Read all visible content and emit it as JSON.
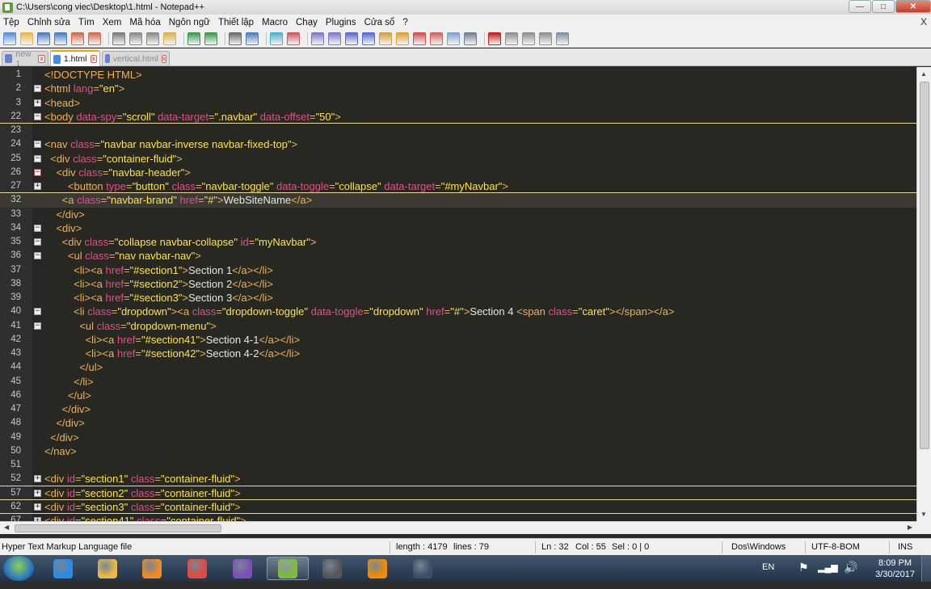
{
  "window": {
    "title": "C:\\Users\\cong viec\\Desktop\\1.html - Notepad++",
    "controls": {
      "minimize": "—",
      "restore": "□",
      "close": "✕"
    }
  },
  "menu": {
    "items": [
      "Tệp",
      "Chỉnh sửa",
      "Tìm",
      "Xem",
      "Mã hóa",
      "Ngôn ngữ",
      "Thiết lập",
      "Macro",
      "Chạy",
      "Plugins",
      "Cửa sổ",
      "?"
    ],
    "doc_close": "X"
  },
  "toolbar": {
    "icons": [
      "new-file-icon",
      "open-file-icon",
      "save-icon",
      "save-all-icon",
      "close-icon",
      "close-all-icon",
      "print-icon",
      "cut-icon",
      "copy-icon",
      "paste-icon",
      "undo-icon",
      "redo-icon",
      "find-icon",
      "replace-icon",
      "zoom-in-icon",
      "zoom-out-icon",
      "sync-v-icon",
      "sync-h-icon",
      "word-wrap-icon",
      "all-chars-icon",
      "indent-guide-icon",
      "folder-icon",
      "function-list-icon",
      "doc-map-icon",
      "panel-icon",
      "monitor-icon",
      "record-macro-icon",
      "stop-macro-icon",
      "play-macro-icon",
      "run-macro-multiple-icon",
      "save-macro-icon"
    ]
  },
  "tabs": [
    {
      "label": "new 1",
      "active": false
    },
    {
      "label": "1.html",
      "active": true
    },
    {
      "label": "vertical.html",
      "active": false
    }
  ],
  "editor": {
    "lines": [
      {
        "n": "1",
        "fold": "",
        "segs": [
          [
            "t",
            "<!DOCTYPE HTML>"
          ]
        ]
      },
      {
        "n": "2",
        "fold": "-",
        "segs": [
          [
            "t",
            "<html "
          ],
          [
            "a",
            "lang"
          ],
          [
            "t",
            "="
          ],
          [
            "v",
            "\"en\""
          ],
          [
            "t",
            ">"
          ]
        ]
      },
      {
        "n": "3",
        "fold": "+",
        "segs": [
          [
            "t",
            "<head>"
          ]
        ]
      },
      {
        "n": "22",
        "fold": "-",
        "segs": [
          [
            "t",
            "<body "
          ],
          [
            "a",
            "data-spy"
          ],
          [
            "t",
            "="
          ],
          [
            "v",
            "\"scroll\""
          ],
          [
            "t",
            " "
          ],
          [
            "a",
            "data-target"
          ],
          [
            "t",
            "="
          ],
          [
            "v",
            "\".navbar\""
          ],
          [
            "t",
            " "
          ],
          [
            "a",
            "data-offset"
          ],
          [
            "t",
            "="
          ],
          [
            "v",
            "\"50\""
          ],
          [
            "t",
            ">"
          ]
        ],
        "underline": true
      },
      {
        "n": "23",
        "fold": "",
        "segs": []
      },
      {
        "n": "24",
        "fold": "-",
        "segs": [
          [
            "t",
            "<nav "
          ],
          [
            "a",
            "class"
          ],
          [
            "t",
            "="
          ],
          [
            "v",
            "\"navbar navbar-inverse navbar-fixed-top\""
          ],
          [
            "t",
            ">"
          ]
        ]
      },
      {
        "n": "25",
        "fold": "-",
        "segs": [
          [
            "tx",
            "  "
          ],
          [
            "t",
            "<div "
          ],
          [
            "a",
            "class"
          ],
          [
            "t",
            "="
          ],
          [
            "v",
            "\"container-fluid\""
          ],
          [
            "t",
            ">"
          ]
        ]
      },
      {
        "n": "26",
        "fold": "-r",
        "segs": [
          [
            "tx",
            "    "
          ],
          [
            "t",
            "<div "
          ],
          [
            "a",
            "class"
          ],
          [
            "t",
            "="
          ],
          [
            "v",
            "\"navbar-header\""
          ],
          [
            "t",
            ">"
          ]
        ]
      },
      {
        "n": "27",
        "fold": "+",
        "segs": [
          [
            "tx",
            "        "
          ],
          [
            "t",
            "<button "
          ],
          [
            "a",
            "type"
          ],
          [
            "t",
            "="
          ],
          [
            "v",
            "\"button\""
          ],
          [
            "t",
            " "
          ],
          [
            "a",
            "class"
          ],
          [
            "t",
            "="
          ],
          [
            "v",
            "\"navbar-toggle\""
          ],
          [
            "t",
            " "
          ],
          [
            "a",
            "data-toggle"
          ],
          [
            "t",
            "="
          ],
          [
            "v",
            "\"collapse\""
          ],
          [
            "t",
            " "
          ],
          [
            "a",
            "data-target"
          ],
          [
            "t",
            "="
          ],
          [
            "v",
            "\"#myNavbar\""
          ],
          [
            "t",
            ">"
          ]
        ],
        "underline": true
      },
      {
        "n": "32",
        "fold": "",
        "segs": [
          [
            "tx",
            "      "
          ],
          [
            "t",
            "<a "
          ],
          [
            "a",
            "class"
          ],
          [
            "t",
            "="
          ],
          [
            "v",
            "\"navbar-brand\""
          ],
          [
            "t",
            " "
          ],
          [
            "a",
            "href"
          ],
          [
            "t",
            "="
          ],
          [
            "v",
            "\"#\""
          ],
          [
            "t",
            ">"
          ],
          [
            "tx",
            "WebSiteName"
          ],
          [
            "t",
            "</a>"
          ]
        ],
        "current": true
      },
      {
        "n": "33",
        "fold": "",
        "segs": [
          [
            "tx",
            "    "
          ],
          [
            "t",
            "</div>"
          ]
        ]
      },
      {
        "n": "34",
        "fold": "-",
        "segs": [
          [
            "tx",
            "    "
          ],
          [
            "t",
            "<div>"
          ]
        ]
      },
      {
        "n": "35",
        "fold": "-",
        "segs": [
          [
            "tx",
            "      "
          ],
          [
            "t",
            "<div "
          ],
          [
            "a",
            "class"
          ],
          [
            "t",
            "="
          ],
          [
            "v",
            "\"collapse navbar-collapse\""
          ],
          [
            "t",
            " "
          ],
          [
            "a",
            "id"
          ],
          [
            "t",
            "="
          ],
          [
            "v",
            "\"myNavbar\""
          ],
          [
            "t",
            ">"
          ]
        ]
      },
      {
        "n": "36",
        "fold": "-",
        "segs": [
          [
            "tx",
            "        "
          ],
          [
            "t",
            "<ul "
          ],
          [
            "a",
            "class"
          ],
          [
            "t",
            "="
          ],
          [
            "v",
            "\"nav navbar-nav\""
          ],
          [
            "t",
            ">"
          ]
        ]
      },
      {
        "n": "37",
        "fold": "",
        "segs": [
          [
            "tx",
            "          "
          ],
          [
            "t",
            "<li><a "
          ],
          [
            "a",
            "href"
          ],
          [
            "t",
            "="
          ],
          [
            "v",
            "\"#section1\""
          ],
          [
            "t",
            ">"
          ],
          [
            "tx",
            "Section 1"
          ],
          [
            "t",
            "</a></li>"
          ]
        ]
      },
      {
        "n": "38",
        "fold": "",
        "segs": [
          [
            "tx",
            "          "
          ],
          [
            "t",
            "<li><a "
          ],
          [
            "a",
            "href"
          ],
          [
            "t",
            "="
          ],
          [
            "v",
            "\"#section2\""
          ],
          [
            "t",
            ">"
          ],
          [
            "tx",
            "Section 2"
          ],
          [
            "t",
            "</a></li>"
          ]
        ]
      },
      {
        "n": "39",
        "fold": "",
        "segs": [
          [
            "tx",
            "          "
          ],
          [
            "t",
            "<li><a "
          ],
          [
            "a",
            "href"
          ],
          [
            "t",
            "="
          ],
          [
            "v",
            "\"#section3\""
          ],
          [
            "t",
            ">"
          ],
          [
            "tx",
            "Section 3"
          ],
          [
            "t",
            "</a></li>"
          ]
        ]
      },
      {
        "n": "40",
        "fold": "-",
        "segs": [
          [
            "tx",
            "          "
          ],
          [
            "t",
            "<li "
          ],
          [
            "a",
            "class"
          ],
          [
            "t",
            "="
          ],
          [
            "v",
            "\"dropdown\""
          ],
          [
            "t",
            "><a "
          ],
          [
            "a",
            "class"
          ],
          [
            "t",
            "="
          ],
          [
            "v",
            "\"dropdown-toggle\""
          ],
          [
            "t",
            " "
          ],
          [
            "a",
            "data-toggle"
          ],
          [
            "t",
            "="
          ],
          [
            "v",
            "\"dropdown\""
          ],
          [
            "t",
            " "
          ],
          [
            "a",
            "href"
          ],
          [
            "t",
            "="
          ],
          [
            "v",
            "\"#\""
          ],
          [
            "t",
            ">"
          ],
          [
            "tx",
            "Section 4 "
          ],
          [
            "t",
            "<span "
          ],
          [
            "a",
            "class"
          ],
          [
            "t",
            "="
          ],
          [
            "v",
            "\"caret\""
          ],
          [
            "t",
            "></span></a>"
          ]
        ]
      },
      {
        "n": "41",
        "fold": "-",
        "segs": [
          [
            "tx",
            "            "
          ],
          [
            "t",
            "<ul "
          ],
          [
            "a",
            "class"
          ],
          [
            "t",
            "="
          ],
          [
            "v",
            "\"dropdown-menu\""
          ],
          [
            "t",
            ">"
          ]
        ]
      },
      {
        "n": "42",
        "fold": "",
        "segs": [
          [
            "tx",
            "              "
          ],
          [
            "t",
            "<li><a "
          ],
          [
            "a",
            "href"
          ],
          [
            "t",
            "="
          ],
          [
            "v",
            "\"#section41\""
          ],
          [
            "t",
            ">"
          ],
          [
            "tx",
            "Section 4-1"
          ],
          [
            "t",
            "</a></li>"
          ]
        ]
      },
      {
        "n": "43",
        "fold": "",
        "segs": [
          [
            "tx",
            "              "
          ],
          [
            "t",
            "<li><a "
          ],
          [
            "a",
            "href"
          ],
          [
            "t",
            "="
          ],
          [
            "v",
            "\"#section42\""
          ],
          [
            "t",
            ">"
          ],
          [
            "tx",
            "Section 4-2"
          ],
          [
            "t",
            "</a></li>"
          ]
        ]
      },
      {
        "n": "44",
        "fold": "",
        "segs": [
          [
            "tx",
            "            "
          ],
          [
            "t",
            "</ul>"
          ]
        ]
      },
      {
        "n": "45",
        "fold": "",
        "segs": [
          [
            "tx",
            "          "
          ],
          [
            "t",
            "</li>"
          ]
        ]
      },
      {
        "n": "46",
        "fold": "",
        "segs": [
          [
            "tx",
            "        "
          ],
          [
            "t",
            "</ul>"
          ]
        ]
      },
      {
        "n": "47",
        "fold": "",
        "segs": [
          [
            "tx",
            "      "
          ],
          [
            "t",
            "</div>"
          ]
        ]
      },
      {
        "n": "48",
        "fold": "",
        "segs": [
          [
            "tx",
            "    "
          ],
          [
            "t",
            "</div>"
          ]
        ]
      },
      {
        "n": "49",
        "fold": "",
        "segs": [
          [
            "tx",
            "  "
          ],
          [
            "t",
            "</div>"
          ]
        ]
      },
      {
        "n": "50",
        "fold": "",
        "segs": [
          [
            "t",
            "</nav>"
          ]
        ]
      },
      {
        "n": "51",
        "fold": "",
        "segs": []
      },
      {
        "n": "52",
        "fold": "+",
        "segs": [
          [
            "t",
            "<div "
          ],
          [
            "a",
            "id"
          ],
          [
            "t",
            "="
          ],
          [
            "v",
            "\"section1\""
          ],
          [
            "t",
            " "
          ],
          [
            "a",
            "class"
          ],
          [
            "t",
            "="
          ],
          [
            "v",
            "\"container-fluid\""
          ],
          [
            "t",
            ">"
          ]
        ],
        "underline": true
      },
      {
        "n": "57",
        "fold": "+",
        "segs": [
          [
            "t",
            "<div "
          ],
          [
            "a",
            "id"
          ],
          [
            "t",
            "="
          ],
          [
            "v",
            "\"section2\""
          ],
          [
            "t",
            " "
          ],
          [
            "a",
            "class"
          ],
          [
            "t",
            "="
          ],
          [
            "v",
            "\"container-fluid\""
          ],
          [
            "t",
            ">"
          ]
        ],
        "underline": true
      },
      {
        "n": "62",
        "fold": "+",
        "segs": [
          [
            "t",
            "<div "
          ],
          [
            "a",
            "id"
          ],
          [
            "t",
            "="
          ],
          [
            "v",
            "\"section3\""
          ],
          [
            "t",
            " "
          ],
          [
            "a",
            "class"
          ],
          [
            "t",
            "="
          ],
          [
            "v",
            "\"container-fluid\""
          ],
          [
            "t",
            ">"
          ]
        ],
        "underline": true
      },
      {
        "n": "67",
        "fold": "+",
        "segs": [
          [
            "t",
            "<div "
          ],
          [
            "a",
            "id"
          ],
          [
            "t",
            "="
          ],
          [
            "v",
            "\"section41\""
          ],
          [
            "t",
            " "
          ],
          [
            "a",
            "class"
          ],
          [
            "t",
            "="
          ],
          [
            "v",
            "\"container-fluid\""
          ],
          [
            "t",
            ">"
          ]
        ]
      }
    ]
  },
  "status": {
    "language": "Hyper Text Markup Language file",
    "length": "length : 4179",
    "lines": "lines : 79",
    "ln": "Ln : 32",
    "col": "Col : 55",
    "sel": "Sel : 0 | 0",
    "eol": "Dos\\Windows",
    "encoding": "UTF-8-BOM",
    "mode": "INS"
  },
  "taskbar": {
    "apps": [
      {
        "name": "internet-explorer-icon",
        "color": "#2a8be6"
      },
      {
        "name": "file-explorer-icon",
        "color": "#e9b949"
      },
      {
        "name": "media-player-icon",
        "color": "#f08a24"
      },
      {
        "name": "chrome-icon",
        "color": "#e24b3b"
      },
      {
        "name": "visual-studio-icon",
        "color": "#7a4fb8"
      },
      {
        "name": "notepadpp-icon",
        "color": "#7dbb3c",
        "active": true
      },
      {
        "name": "film-icon",
        "color": "#555555"
      },
      {
        "name": "vlc-icon",
        "color": "#f08c00"
      },
      {
        "name": "document-icon",
        "color": "#3d4f66"
      }
    ],
    "lang": "EN",
    "time": "8:09 PM",
    "date": "3/30/2017"
  }
}
